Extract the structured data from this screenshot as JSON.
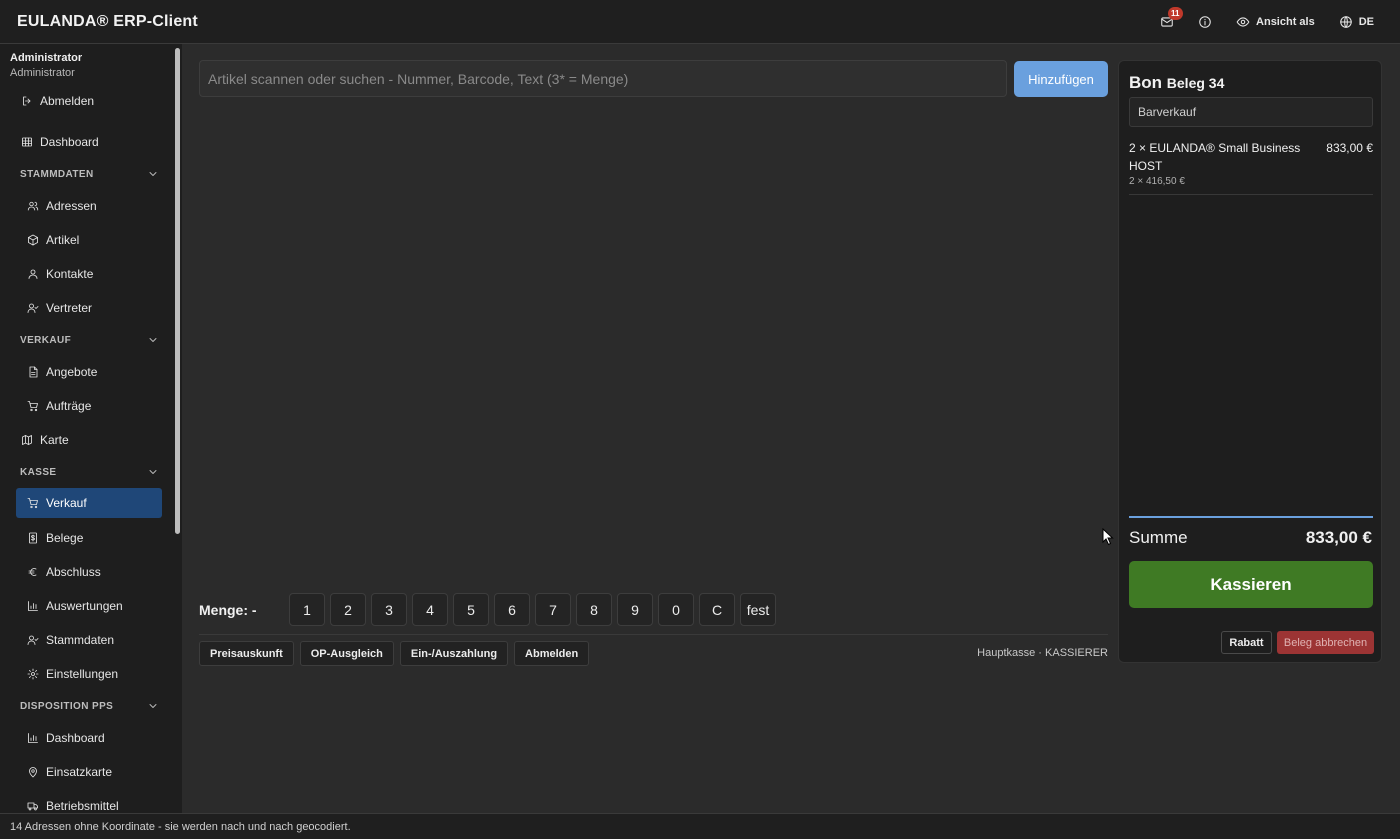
{
  "header": {
    "title": "EULANDA® ERP-Client",
    "mail_count": "11",
    "view_as_label": "Ansicht als",
    "language_label": "DE"
  },
  "sidebar": {
    "user_name": "Administrator",
    "user_role": "Administrator",
    "logout_label": "Abmelden",
    "dashboard_label": "Dashboard",
    "sections": [
      {
        "label": "STAMMDATEN",
        "items": [
          "Adressen",
          "Artikel",
          "Kontakte",
          "Vertreter"
        ]
      },
      {
        "label": "VERKAUF",
        "items": [
          "Angebote",
          "Aufträge"
        ]
      },
      {
        "label": "KASSE",
        "items": [
          "Verkauf",
          "Belege",
          "Abschluss",
          "Auswertungen",
          "Stammdaten",
          "Einstellungen"
        ]
      },
      {
        "label": "DISPOSITION PPS",
        "items": [
          "Dashboard",
          "Einsatzkarte",
          "Betriebsmittel"
        ]
      }
    ],
    "map_label": "Karte",
    "active_item": "Verkauf"
  },
  "pos": {
    "search_placeholder": "Artikel scannen oder suchen - Nummer, Barcode, Text (3* = Menge)",
    "add_label": "Hinzufügen",
    "quantity_label": "Menge: -",
    "keypad": [
      "1",
      "2",
      "3",
      "4",
      "5",
      "6",
      "7",
      "8",
      "9",
      "0",
      "C",
      "fest"
    ],
    "actions": [
      "Preisauskunft",
      "OP-Ausgleich",
      "Ein-/Auszahlung",
      "Abmelden"
    ],
    "register_info": "Hauptkasse · KASSIERER"
  },
  "receipt": {
    "title": "Bon",
    "document": "Beleg 34",
    "sale_type": "Barverkauf",
    "items": [
      {
        "name": "2 × EULANDA® Small Business HOST",
        "total": "833,00 €",
        "unit": "2 × 416,50 €"
      }
    ],
    "sum_label": "Summe",
    "sum_value": "833,00 €",
    "pay_label": "Kassieren",
    "discount_label": "Rabatt",
    "cancel_label": "Beleg abbrechen"
  },
  "status_bar": {
    "message": "14 Adressen ohne Koordinate - sie werden nach und nach geocodiert."
  },
  "colors": {
    "accent": "#6aa0de",
    "active_nav": "#1f4778",
    "pay": "#3f7a24",
    "cancel": "#9c3434"
  }
}
